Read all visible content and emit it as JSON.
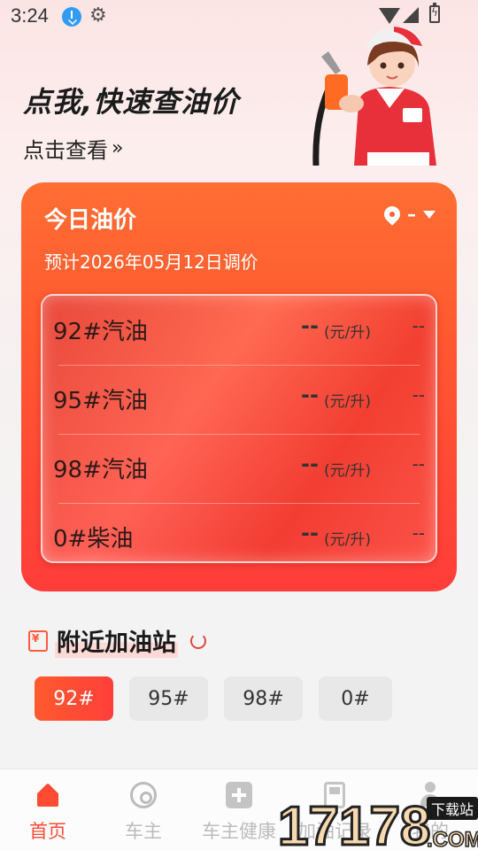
{
  "status_bar": {
    "time": "3:24"
  },
  "hero": {
    "title": "点我,快速查油价",
    "link_label": "点击查看",
    "link_chevron": "»"
  },
  "price_card": {
    "title": "今日油价",
    "location": "–",
    "adjust_date": "预计2026年05月12日调价",
    "rows": [
      {
        "name": "92#汽油",
        "price": "--",
        "unit": "(元/升)",
        "change": "--"
      },
      {
        "name": "95#汽油",
        "price": "--",
        "unit": "(元/升)",
        "change": "--"
      },
      {
        "name": "98#汽油",
        "price": "--",
        "unit": "(元/升)",
        "change": "--"
      },
      {
        "name": "0#柴油",
        "price": "--",
        "unit": "(元/升)",
        "change": "--"
      }
    ]
  },
  "nearby": {
    "title": "附近加油站",
    "tabs": [
      "92#",
      "95#",
      "98#",
      "0#"
    ],
    "selected_tab": "92#"
  },
  "bottom_nav": {
    "items": [
      "首页",
      "车主",
      "车主健康",
      "加油记录",
      "我的"
    ],
    "active": "首页"
  },
  "watermark": {
    "number": "17178",
    "badge": "下载站",
    "domain": ".COM"
  },
  "colors": {
    "accent": "#ff4a34",
    "card_top": "#ff6e33",
    "card_bottom": "#ff3d3a"
  }
}
